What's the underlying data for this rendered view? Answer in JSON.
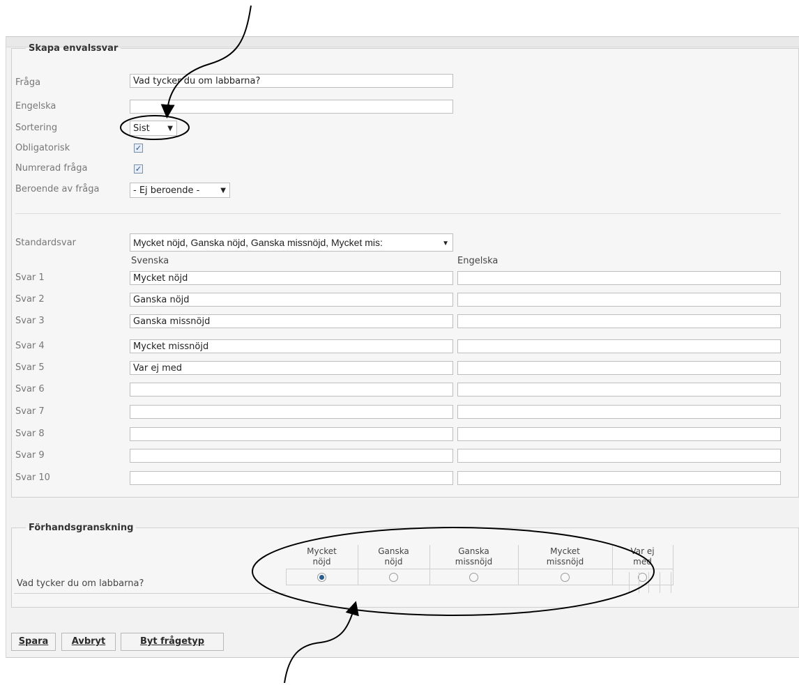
{
  "form": {
    "legend": "Skapa envalssvar",
    "fraga": {
      "label": "Fråga",
      "value": "Vad tycker du om labbarna?"
    },
    "engelska": {
      "label": "Engelska",
      "value": ""
    },
    "sortering": {
      "label": "Sortering",
      "value": "Sist"
    },
    "obligatorisk": {
      "label": "Obligatorisk",
      "checked": true
    },
    "numrerad": {
      "label": "Numrerad fråga",
      "checked": true
    },
    "beroende": {
      "label": "Beroende av fråga",
      "value": "- Ej beroende -"
    },
    "standardsvar": {
      "label": "Standardsvar",
      "value": "Mycket nöjd, Ganska nöjd, Ganska missnöjd, Mycket mis:"
    },
    "col_svenska": "Svenska",
    "col_engelska": "Engelska",
    "svar": [
      {
        "label": "Svar 1",
        "sv": "Mycket nöjd",
        "en": ""
      },
      {
        "label": "Svar 2",
        "sv": "Ganska nöjd",
        "en": ""
      },
      {
        "label": "Svar 3",
        "sv": "Ganska missnöjd",
        "en": ""
      },
      {
        "label": "Svar 4",
        "sv": "Mycket missnöjd",
        "en": ""
      },
      {
        "label": "Svar 5",
        "sv": "Var ej med",
        "en": ""
      },
      {
        "label": "Svar 6",
        "sv": "",
        "en": ""
      },
      {
        "label": "Svar 7",
        "sv": "",
        "en": ""
      },
      {
        "label": "Svar 8",
        "sv": "",
        "en": ""
      },
      {
        "label": "Svar 9",
        "sv": "",
        "en": ""
      },
      {
        "label": "Svar 10",
        "sv": "",
        "en": ""
      }
    ]
  },
  "preview": {
    "legend": "Förhandsgranskning",
    "question": "Vad tycker du om labbarna?",
    "options": [
      {
        "line1": "Mycket",
        "line2": "nöjd",
        "selected": true
      },
      {
        "line1": "Ganska",
        "line2": "nöjd",
        "selected": false
      },
      {
        "line1": "Ganska",
        "line2": "missnöjd",
        "selected": false
      },
      {
        "line1": "Mycket",
        "line2": "missnöjd",
        "selected": false
      },
      {
        "line1": "Var ej",
        "line2": "med",
        "selected": false
      }
    ]
  },
  "buttons": {
    "spara": "Spara",
    "avbryt": "Avbryt",
    "byt": "Byt frågetyp"
  },
  "icons": {
    "checkbox_mark": "✓",
    "dropdown": "▼"
  }
}
